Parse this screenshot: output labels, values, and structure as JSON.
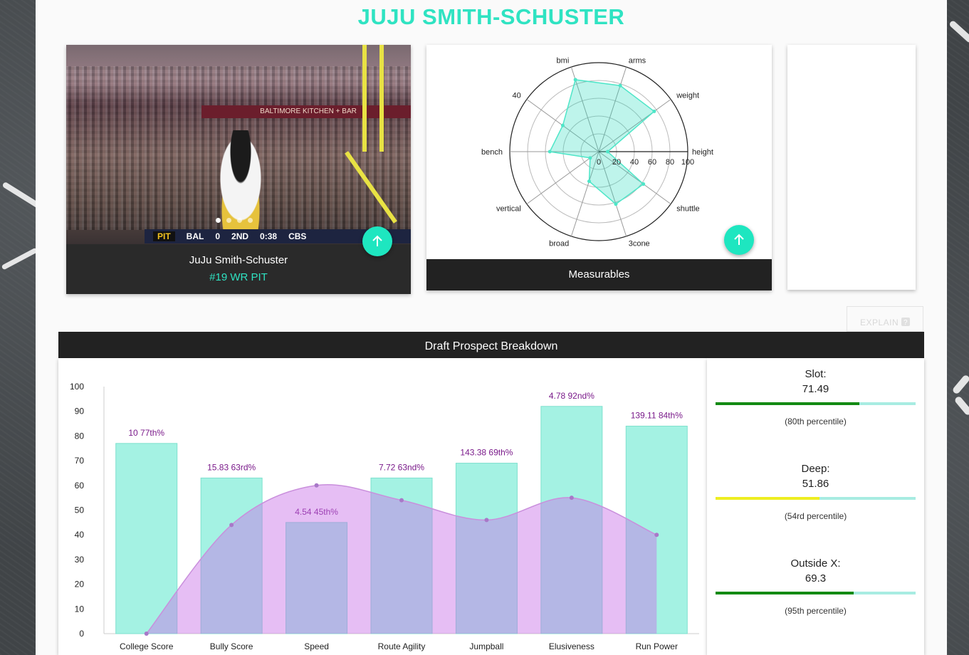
{
  "page": {
    "title": "JUJU SMITH-SCHUSTER"
  },
  "player_card": {
    "name": "JuJu Smith-Schuster",
    "subtitle": "#19 WR PIT",
    "photo": {
      "banner_text": "BALTIMORE KITCHEN + BAR",
      "scorebug": {
        "team1": "PIT",
        "team2": "BAL",
        "score2": "0",
        "quarter": "2ND",
        "clock": "0:38",
        "network": "CBS"
      },
      "carousel_dots": 4,
      "active_dot": 0
    },
    "fab_icon": "arrow-up-icon"
  },
  "measurables": {
    "footer_label": "Measurables",
    "fab_icon": "arrow-up-icon",
    "radar": {
      "axes": [
        "height",
        "weight",
        "arms",
        "bmi",
        "40",
        "bench",
        "vertical",
        "broad",
        "3cone",
        "shuttle"
      ],
      "values": [
        10,
        77,
        78,
        85,
        50,
        55,
        12,
        35,
        62,
        62
      ],
      "ticks": [
        "0",
        "20",
        "40",
        "60",
        "80",
        "100"
      ],
      "max": 100
    }
  },
  "explain_button": {
    "label": "EXPLAIN",
    "icon": "help-icon"
  },
  "breakdown": {
    "header": "Draft Prospect Breakdown",
    "chart_data": {
      "type": "bar",
      "categories": [
        "College Score",
        "Bully Score",
        "Speed",
        "Route Agility",
        "Jumpball",
        "Elusiveness",
        "Run Power"
      ],
      "series": [
        {
          "values": [
            77,
            63,
            45,
            63,
            69,
            92,
            84
          ],
          "color": "#a4f2e3"
        },
        {
          "values": [
            0,
            44,
            60,
            54,
            46,
            55,
            40
          ],
          "color": "#d9a0f0"
        }
      ],
      "bar_labels": [
        "10 77th%",
        "15.83 63rd%",
        "4.54 45th%",
        "7.72 63nd%",
        "143.38 69th%",
        "4.78 92nd%",
        "139.11 84th%"
      ],
      "yticks": [
        "0",
        "10",
        "20",
        "30",
        "40",
        "50",
        "60",
        "70",
        "80",
        "90",
        "100"
      ],
      "ylim": [
        0,
        100
      ]
    }
  },
  "percentiles": [
    {
      "label": "Slot:",
      "value": "71.49",
      "fill": 0.72,
      "color": "#138a13",
      "note": "(80th percentile)"
    },
    {
      "label": "Deep:",
      "value": "51.86",
      "fill": 0.52,
      "color": "#eeee22",
      "note": "(54rd percentile)"
    },
    {
      "label": "Outside X:",
      "value": "69.3",
      "fill": 0.69,
      "color": "#138a13",
      "note": "(95th percentile)"
    }
  ]
}
